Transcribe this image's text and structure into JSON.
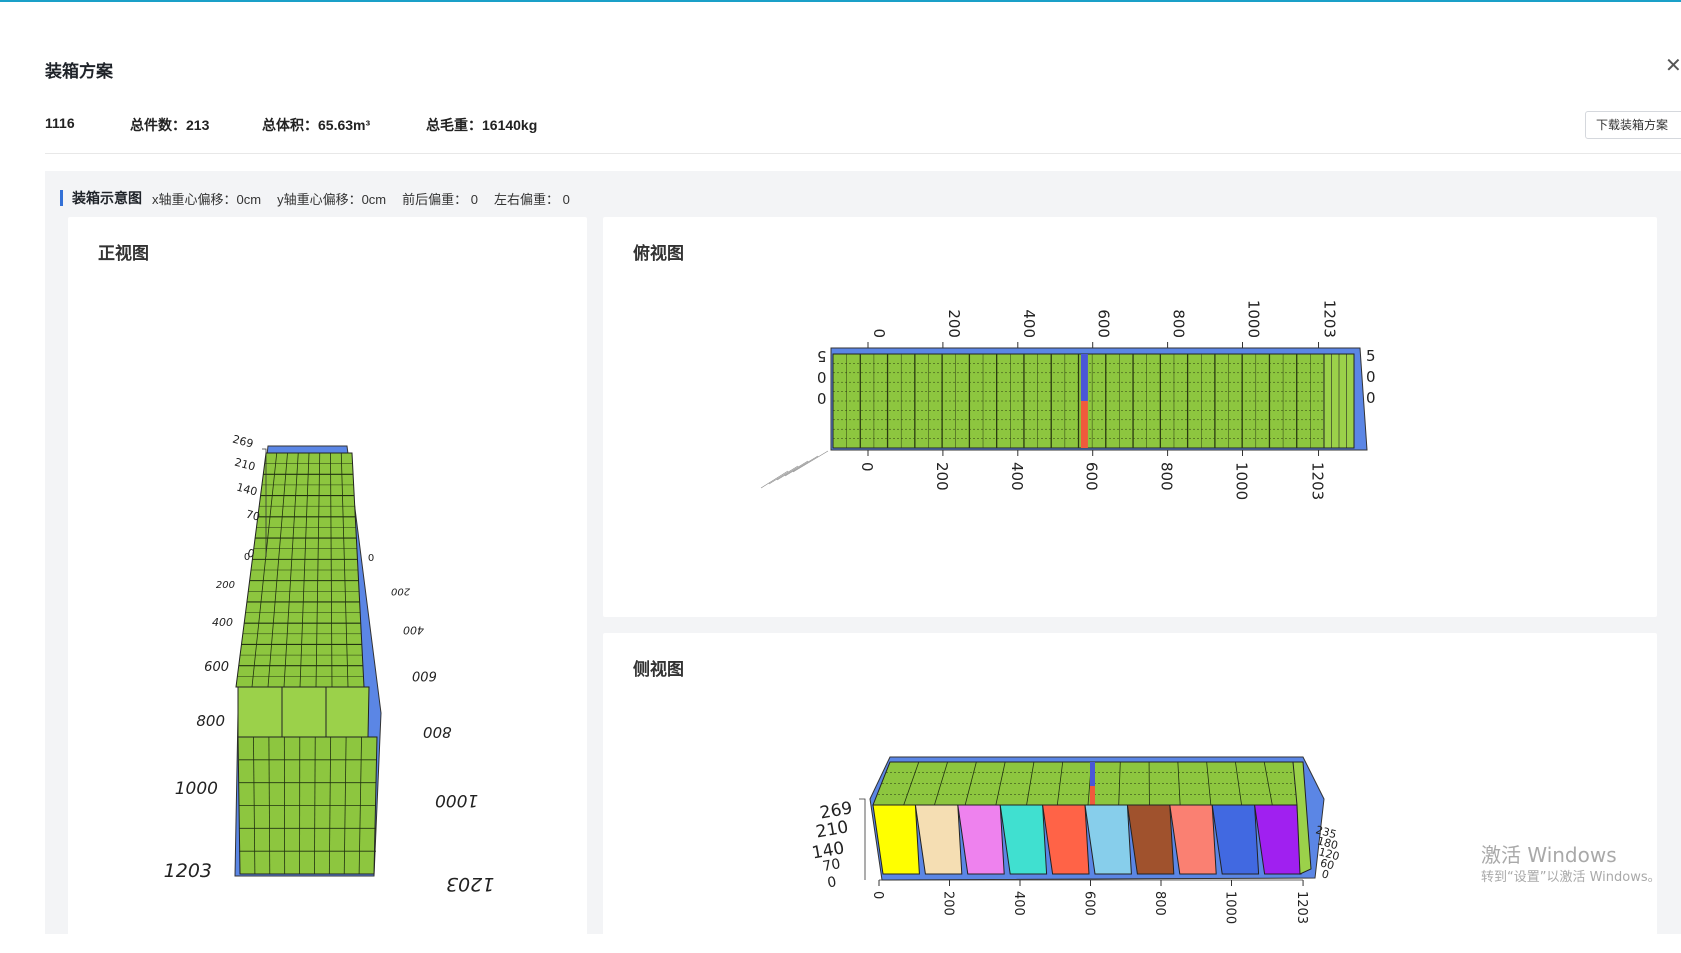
{
  "dialog": {
    "title": "装箱方案",
    "close_icon": "close-icon",
    "summary": {
      "id": "1116",
      "count": "总件数：213",
      "volume": "总体积：65.63m³",
      "weight": "总毛重：16140kg"
    },
    "download_label": "下载装箱方案"
  },
  "section": {
    "title": "装箱示意图",
    "x_offset": "x轴重心偏移：0cm",
    "y_offset": "y轴重心偏移：0cm",
    "front_back": "前后偏重：  0",
    "left_right": "左右偏重：  0"
  },
  "views": {
    "front": {
      "title": "正视图"
    },
    "top": {
      "title": "俯视图"
    },
    "side": {
      "title": "侧视图"
    }
  },
  "axis": {
    "length_ticks": [
      "0",
      "200",
      "400",
      "600",
      "800",
      "1000",
      "1203"
    ],
    "height_ticks": [
      "269",
      "210",
      "140",
      "70",
      "0"
    ],
    "width_ticks": [
      "0",
      "60",
      "120",
      "180",
      "235"
    ],
    "top_side_ticks": [
      "5",
      "0",
      "0"
    ]
  },
  "colors": {
    "cargo_green": "#8dc63f",
    "container_blue": "#5b86e5",
    "accent_blue": "#3370d6",
    "side_segments": [
      "#ffff00",
      "#f5deb3",
      "#ee82ee",
      "#40e0d0",
      "#ff6347",
      "#87ceeb",
      "#a0522d",
      "#fa8072",
      "#4169e1",
      "#a020f0"
    ]
  },
  "watermark": {
    "line1": "激活 Windows",
    "line2": "转到“设置”以激活 Windows。"
  }
}
